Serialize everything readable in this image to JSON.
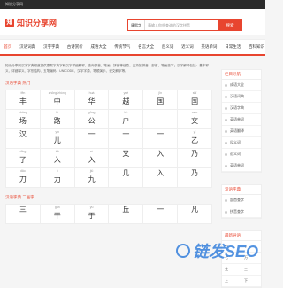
{
  "window_title": "知识分享网",
  "logo": {
    "text": "知识分享网",
    "mark": "知"
  },
  "search": {
    "select": "康熙字",
    "placeholder": "请输入你想查询的汉字拼音",
    "button": "搜索"
  },
  "nav": [
    "首页",
    "汉语词典",
    "汉字字典",
    "古诗赏析",
    "成语大全",
    "传统节气",
    "名言大全",
    "反义词",
    "近义词",
    "英语单词",
    "日常生活",
    "百科知识"
  ],
  "intro": "知识分享网汉字字典频道提供康熙字典字和汉字详细解释，查询部首、笔画、拼音等信息，支持按拼音、部首、笔画查字；汉字解释包括：基本释义、详细释义、字形结构、五笔编码、UNICODE、汉字字源、笔顺演示、说文解字等。",
  "section1_title": "汉语字典 热门",
  "grid1": [
    {
      "py": "fēn",
      "hz": "丰"
    },
    {
      "py": "zhōng/zhòng",
      "hz": "中"
    },
    {
      "py": "huá",
      "hz": "华"
    },
    {
      "py": "yuè",
      "hz": "越"
    },
    {
      "py": "jīn",
      "hz": "国"
    },
    {
      "py": "shī",
      "hz": "国"
    },
    {
      "py": "chǎng",
      "hz": "场"
    },
    {
      "py": "lù",
      "hz": "路"
    },
    {
      "py": "gōng",
      "hz": "公"
    },
    {
      "py": "hù",
      "hz": "户"
    },
    {
      "py": "",
      "hz": ""
    },
    {
      "py": "wén",
      "hz": "文"
    },
    {
      "py": "",
      "hz": "汉"
    },
    {
      "py": "yǐn",
      "hz": "儿"
    },
    {
      "py": "",
      "hz": "一"
    },
    {
      "py": "",
      "hz": "一"
    },
    {
      "py": "",
      "hz": "一"
    },
    {
      "py": "yǐ",
      "hz": "乙"
    },
    {
      "py": "dīng",
      "hz": "了"
    },
    {
      "py": "bā",
      "hz": "入"
    },
    {
      "py": "rù",
      "hz": "入"
    },
    {
      "py": "",
      "hz": "又"
    },
    {
      "py": "",
      "hz": "入"
    },
    {
      "py": "",
      "hz": "乃"
    },
    {
      "py": "dāo",
      "hz": "刀"
    },
    {
      "py": "lì",
      "hz": "力"
    },
    {
      "py": "jiǔ",
      "hz": "九"
    },
    {
      "py": "",
      "hz": "几"
    },
    {
      "py": "",
      "hz": "入"
    },
    {
      "py": "",
      "hz": "乃"
    }
  ],
  "section2_title": "汉语字典 二画字",
  "grid2": [
    {
      "py": "",
      "hz": "三"
    },
    {
      "py": "gān",
      "hz": "干"
    },
    {
      "py": "yú",
      "hz": "于"
    },
    {
      "py": "",
      "hz": "丘"
    },
    {
      "py": "",
      "hz": "一"
    },
    {
      "py": "",
      "hz": "凡"
    }
  ],
  "sidebar": {
    "box1_title": "栏目导航",
    "box1_items": [
      "成语大全",
      "汉语词典",
      "汉语字典",
      "英语单词",
      "英语翻译",
      "反义词",
      "近义词",
      "英语单词"
    ],
    "box2_title": "汉语字典",
    "box2_items": [
      "部首查字",
      "拼音查字"
    ],
    "box3_title": "最新导语",
    "box3_items": [
      "一",
      "丁",
      "七",
      "万",
      "丈",
      "三",
      "上",
      "下"
    ]
  },
  "watermark": "链发SEO",
  "colors": {
    "accent": "#e8452f",
    "watermark": "#1a6fd8"
  }
}
